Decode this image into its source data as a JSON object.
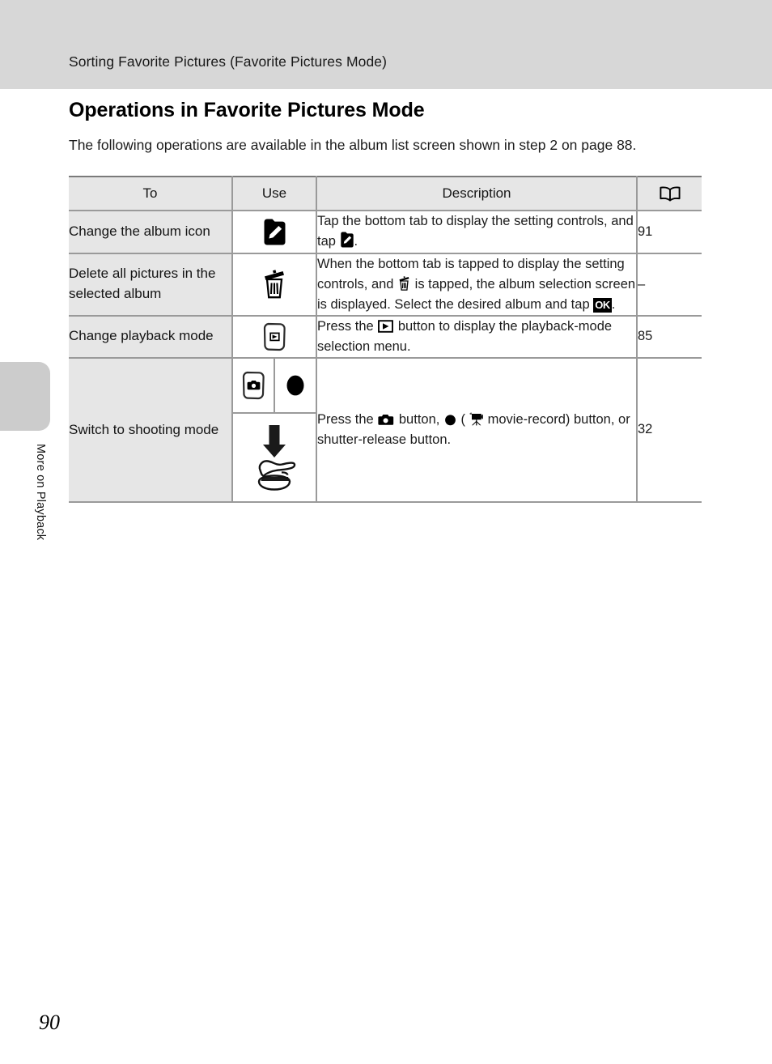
{
  "header": {
    "running_title": "Sorting Favorite Pictures (Favorite Pictures Mode)"
  },
  "sidebar": {
    "tab_label": "More on Playback"
  },
  "page": {
    "number": "90",
    "section_title": "Operations in Favorite Pictures Mode",
    "intro": "The following operations are available in the album list screen shown in step 2 on page 88."
  },
  "table": {
    "headers": {
      "to": "To",
      "use": "Use",
      "description": "Description",
      "reference_icon": "open-book-icon"
    },
    "rows": [
      {
        "to": "Change the album icon",
        "use_icon": "album-icon-edit-icon",
        "description_parts": {
          "before": "Tap the bottom tab to display the setting controls, and tap ",
          "icon": "album-icon-edit-icon",
          "after": "."
        },
        "reference": "91"
      },
      {
        "to": "Delete all pictures in the selected album",
        "use_icon": "trash-icon",
        "description_parts": {
          "before": "When the bottom tab is tapped to display the setting controls, and ",
          "icon": "trash-icon",
          "middle": " is tapped, the album selection screen is displayed. Select the desired album and tap ",
          "icon2": "ok-badge-icon",
          "after": "."
        },
        "reference": "–"
      },
      {
        "to": "Change playback mode",
        "use_icon": "playback-button-icon",
        "description_parts": {
          "before": "Press the ",
          "icon": "play-button-icon",
          "after": " button to display the playback-mode selection menu."
        },
        "reference": "85"
      },
      {
        "to": "Switch to shooting mode",
        "use_icons": [
          "camera-button-icon",
          "record-button-icon",
          "press-shutter-icon"
        ],
        "description_parts": {
          "before": "Press the ",
          "icon": "camera-icon",
          "middle": " button, ",
          "icon2": "record-dot-icon",
          "middle2": " (",
          "icon3": "movie-camera-icon",
          "after": " movie-record) button, or shutter-release button."
        },
        "reference": "32"
      }
    ]
  },
  "colors": {
    "header_band": "#d7d7d7",
    "tab_gray": "#cccccc",
    "cell_gray": "#e6e6e6",
    "rule": "#9a9a9a"
  }
}
